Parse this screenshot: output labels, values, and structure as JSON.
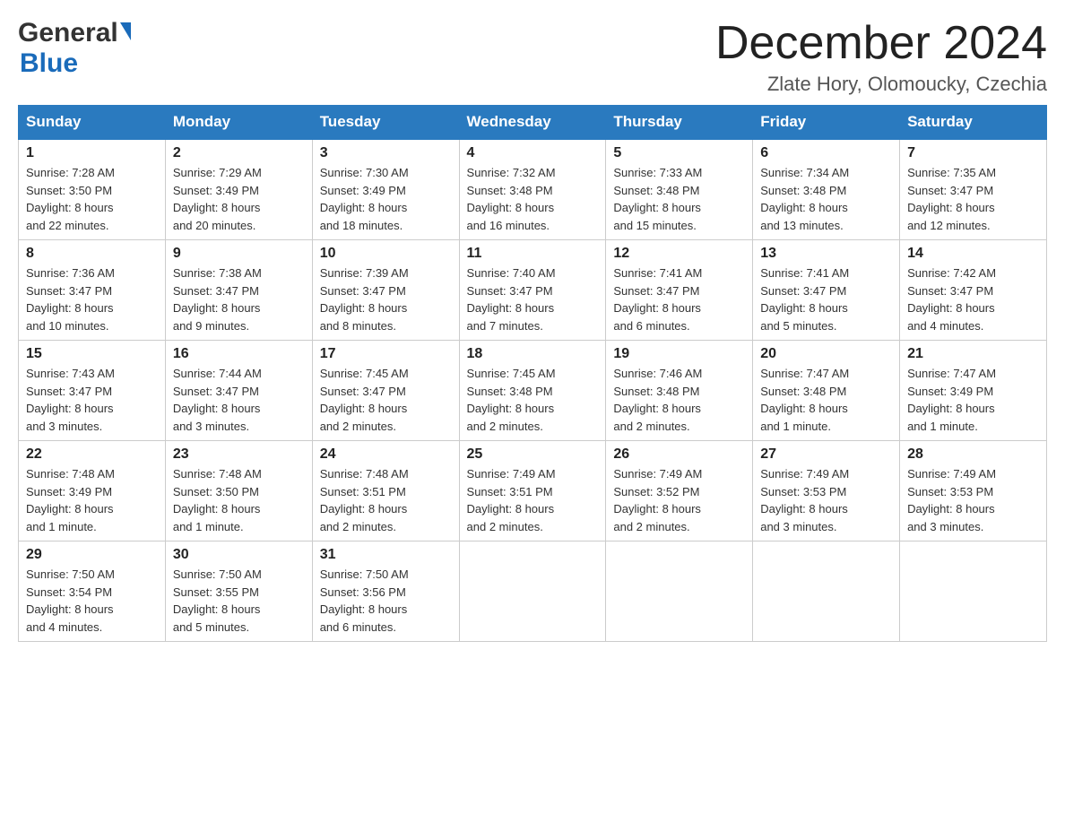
{
  "logo": {
    "general_text": "General",
    "blue_text": "Blue"
  },
  "header": {
    "title": "December 2024",
    "subtitle": "Zlate Hory, Olomoucky, Czechia"
  },
  "days_of_week": [
    "Sunday",
    "Monday",
    "Tuesday",
    "Wednesday",
    "Thursday",
    "Friday",
    "Saturday"
  ],
  "weeks": [
    [
      {
        "day": "1",
        "sunrise": "7:28 AM",
        "sunset": "3:50 PM",
        "daylight": "8 hours and 22 minutes."
      },
      {
        "day": "2",
        "sunrise": "7:29 AM",
        "sunset": "3:49 PM",
        "daylight": "8 hours and 20 minutes."
      },
      {
        "day": "3",
        "sunrise": "7:30 AM",
        "sunset": "3:49 PM",
        "daylight": "8 hours and 18 minutes."
      },
      {
        "day": "4",
        "sunrise": "7:32 AM",
        "sunset": "3:48 PM",
        "daylight": "8 hours and 16 minutes."
      },
      {
        "day": "5",
        "sunrise": "7:33 AM",
        "sunset": "3:48 PM",
        "daylight": "8 hours and 15 minutes."
      },
      {
        "day": "6",
        "sunrise": "7:34 AM",
        "sunset": "3:48 PM",
        "daylight": "8 hours and 13 minutes."
      },
      {
        "day": "7",
        "sunrise": "7:35 AM",
        "sunset": "3:47 PM",
        "daylight": "8 hours and 12 minutes."
      }
    ],
    [
      {
        "day": "8",
        "sunrise": "7:36 AM",
        "sunset": "3:47 PM",
        "daylight": "8 hours and 10 minutes."
      },
      {
        "day": "9",
        "sunrise": "7:38 AM",
        "sunset": "3:47 PM",
        "daylight": "8 hours and 9 minutes."
      },
      {
        "day": "10",
        "sunrise": "7:39 AM",
        "sunset": "3:47 PM",
        "daylight": "8 hours and 8 minutes."
      },
      {
        "day": "11",
        "sunrise": "7:40 AM",
        "sunset": "3:47 PM",
        "daylight": "8 hours and 7 minutes."
      },
      {
        "day": "12",
        "sunrise": "7:41 AM",
        "sunset": "3:47 PM",
        "daylight": "8 hours and 6 minutes."
      },
      {
        "day": "13",
        "sunrise": "7:41 AM",
        "sunset": "3:47 PM",
        "daylight": "8 hours and 5 minutes."
      },
      {
        "day": "14",
        "sunrise": "7:42 AM",
        "sunset": "3:47 PM",
        "daylight": "8 hours and 4 minutes."
      }
    ],
    [
      {
        "day": "15",
        "sunrise": "7:43 AM",
        "sunset": "3:47 PM",
        "daylight": "8 hours and 3 minutes."
      },
      {
        "day": "16",
        "sunrise": "7:44 AM",
        "sunset": "3:47 PM",
        "daylight": "8 hours and 3 minutes."
      },
      {
        "day": "17",
        "sunrise": "7:45 AM",
        "sunset": "3:47 PM",
        "daylight": "8 hours and 2 minutes."
      },
      {
        "day": "18",
        "sunrise": "7:45 AM",
        "sunset": "3:48 PM",
        "daylight": "8 hours and 2 minutes."
      },
      {
        "day": "19",
        "sunrise": "7:46 AM",
        "sunset": "3:48 PM",
        "daylight": "8 hours and 2 minutes."
      },
      {
        "day": "20",
        "sunrise": "7:47 AM",
        "sunset": "3:48 PM",
        "daylight": "8 hours and 1 minute."
      },
      {
        "day": "21",
        "sunrise": "7:47 AM",
        "sunset": "3:49 PM",
        "daylight": "8 hours and 1 minute."
      }
    ],
    [
      {
        "day": "22",
        "sunrise": "7:48 AM",
        "sunset": "3:49 PM",
        "daylight": "8 hours and 1 minute."
      },
      {
        "day": "23",
        "sunrise": "7:48 AM",
        "sunset": "3:50 PM",
        "daylight": "8 hours and 1 minute."
      },
      {
        "day": "24",
        "sunrise": "7:48 AM",
        "sunset": "3:51 PM",
        "daylight": "8 hours and 2 minutes."
      },
      {
        "day": "25",
        "sunrise": "7:49 AM",
        "sunset": "3:51 PM",
        "daylight": "8 hours and 2 minutes."
      },
      {
        "day": "26",
        "sunrise": "7:49 AM",
        "sunset": "3:52 PM",
        "daylight": "8 hours and 2 minutes."
      },
      {
        "day": "27",
        "sunrise": "7:49 AM",
        "sunset": "3:53 PM",
        "daylight": "8 hours and 3 minutes."
      },
      {
        "day": "28",
        "sunrise": "7:49 AM",
        "sunset": "3:53 PM",
        "daylight": "8 hours and 3 minutes."
      }
    ],
    [
      {
        "day": "29",
        "sunrise": "7:50 AM",
        "sunset": "3:54 PM",
        "daylight": "8 hours and 4 minutes."
      },
      {
        "day": "30",
        "sunrise": "7:50 AM",
        "sunset": "3:55 PM",
        "daylight": "8 hours and 5 minutes."
      },
      {
        "day": "31",
        "sunrise": "7:50 AM",
        "sunset": "3:56 PM",
        "daylight": "8 hours and 6 minutes."
      },
      null,
      null,
      null,
      null
    ]
  ],
  "labels": {
    "sunrise": "Sunrise:",
    "sunset": "Sunset:",
    "daylight": "Daylight:"
  }
}
